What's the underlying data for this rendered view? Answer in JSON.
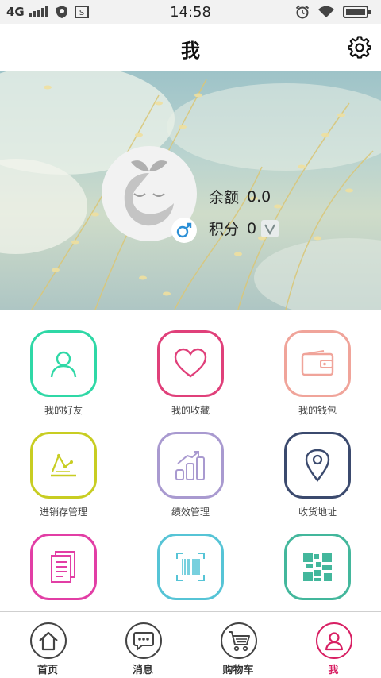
{
  "status_bar": {
    "network": "4G",
    "time": "14:58"
  },
  "header": {
    "title": "我"
  },
  "profile": {
    "balance_label": "余额",
    "balance_value": "0.0",
    "points_label": "积分",
    "points_value": "0"
  },
  "menu": [
    {
      "label": "我的好友",
      "icon": "person-icon",
      "color": "#2fd8a6"
    },
    {
      "label": "我的收藏",
      "icon": "heart-icon",
      "color": "#e0407a"
    },
    {
      "label": "我的钱包",
      "icon": "wallet-icon",
      "color": "#f0a49a"
    },
    {
      "label": "进销存管理",
      "icon": "trend-chart-icon",
      "color": "#c8cd22"
    },
    {
      "label": "绩效管理",
      "icon": "bar-chart-icon",
      "color": "#a99ad0"
    },
    {
      "label": "收货地址",
      "icon": "location-pin-icon",
      "color": "#3b4a6e"
    },
    {
      "label": "",
      "icon": "document-icon",
      "color": "#e23ea5"
    },
    {
      "label": "",
      "icon": "barcode-scan-icon",
      "color": "#56c4d6"
    },
    {
      "label": "",
      "icon": "qr-code-icon",
      "color": "#43b79c"
    }
  ],
  "nav": {
    "home": "首页",
    "messages": "消息",
    "cart": "购物车",
    "me": "我"
  },
  "colors": {
    "accent": "#d81f63",
    "status_bar_bg": "#f2f2f2"
  }
}
